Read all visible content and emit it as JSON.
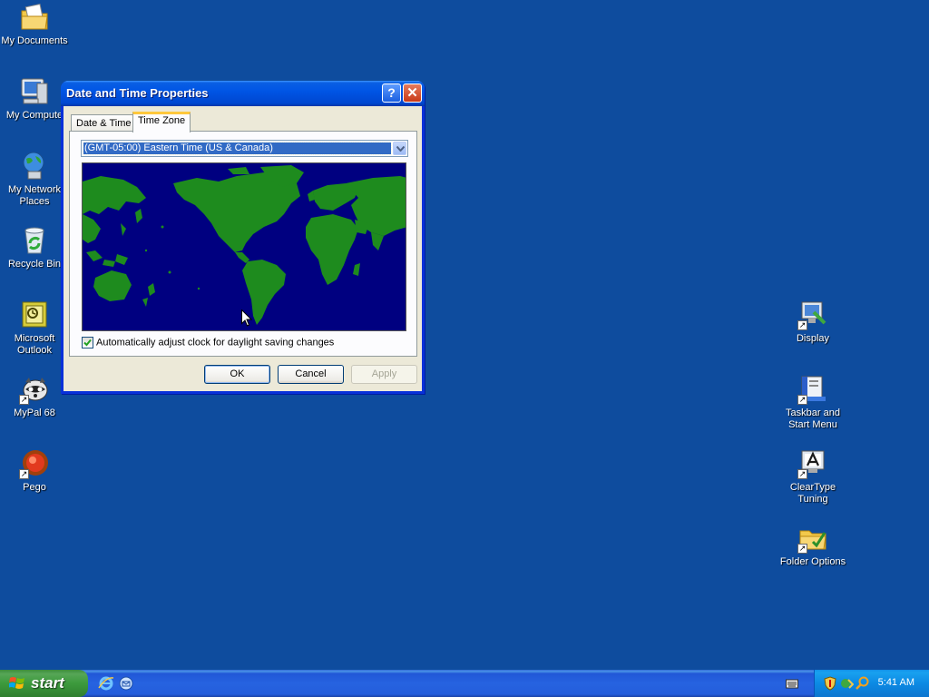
{
  "desktop": {
    "left_icons": [
      {
        "label": "My Documents",
        "icon": "my-documents-icon"
      },
      {
        "label": "My Compute",
        "icon": "my-computer-icon"
      },
      {
        "label": "My Network Places",
        "icon": "network-places-icon"
      },
      {
        "label": "Recycle Bin",
        "icon": "recycle-bin-icon"
      },
      {
        "label": "Microsoft Outlook",
        "icon": "outlook-icon"
      },
      {
        "label": "MyPal 68",
        "icon": "mypal-icon"
      },
      {
        "label": "Pego",
        "icon": "pego-icon"
      }
    ],
    "right_icons": [
      {
        "label": "Display",
        "icon": "display-icon"
      },
      {
        "label": "Taskbar and Start Menu",
        "icon": "taskbar-start-menu-icon"
      },
      {
        "label": "ClearType Tuning",
        "icon": "cleartype-icon"
      },
      {
        "label": "Folder Options",
        "icon": "folder-options-icon"
      }
    ],
    "background_color": "#0e4c9e"
  },
  "dialog": {
    "title": "Date and Time Properties",
    "tabs": [
      {
        "label": "Date & Time",
        "active": false
      },
      {
        "label": "Time Zone",
        "active": true
      }
    ],
    "timezone_selected": "(GMT-05:00) Eastern Time (US & Canada)",
    "dst_label": "Automatically adjust clock for daylight saving changes",
    "dst_checked": true,
    "buttons": {
      "ok": "OK",
      "cancel": "Cancel",
      "apply": "Apply"
    },
    "map_colors": {
      "ocean": "#000080",
      "land": "#1e8b1e"
    }
  },
  "taskbar": {
    "start_label": "start",
    "clock": "5:41 AM",
    "quick_launch": [
      "internet-explorer-icon",
      "email-icon"
    ],
    "tray_icons": [
      "security-shield-icon",
      "network-icon",
      "search-icon"
    ]
  }
}
